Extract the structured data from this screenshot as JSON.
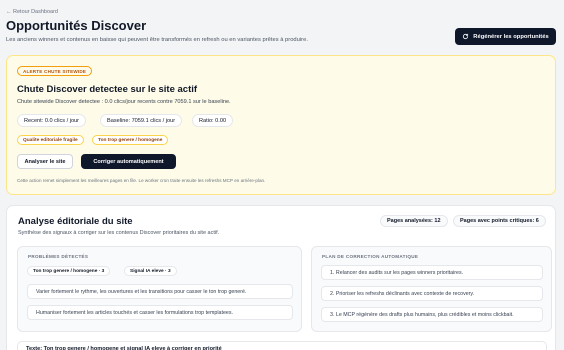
{
  "header": {
    "back_link": "← Retour Dashboard",
    "title": "Opportunités Discover",
    "subtitle": "Les anciens winners et contenus en baisse qui peuvent être transformés en refresh ou en variantes prêtes à produire.",
    "regenerate_label": "Régénérer les opportunités",
    "regenerate_icon": "refresh-icon"
  },
  "alert": {
    "badge": "ALERTE CHUTE SITEWIDE",
    "title": "Chute Discover detectee sur le site actif",
    "description": "Chute sitewide Discover detectee : 0.0 clics/jour recents contre 7059.1 sur le baseline.",
    "metrics": {
      "recent": "Recent: 0.0 clics / jour",
      "baseline": "Baseline: 7059.1 clics / jour",
      "ratio": "Ratio: 0.00"
    },
    "tags": [
      "Qualite editoriale fragile",
      "Ton trop genere / homogene"
    ],
    "analyze_label": "Analyser le site",
    "auto_fix_label": "Corriger automatiquement",
    "footnote": "Cette action remet simplement les meilleures pages en file. Le worker cron traite ensuite les refreshs MCP en arrière-plan."
  },
  "analysis": {
    "title": "Analyse éditoriale du site",
    "subtitle": "Synthèse des signaux à corriger sur les contenus Discover prioritaires du site actif.",
    "pages_analyzed": "Pages analysées: 12",
    "pages_critical": "Pages avec points critiques: 6",
    "problems": {
      "heading": "PROBLÈMES DÉTECTÉS",
      "chips": [
        "Ton trop genere / homogene · 3",
        "Signal IA eleve · 3"
      ],
      "items": [
        "Varier fortement le rythme, les ouvertures et les transitions pour casser le ton trop generé.",
        "Humaniser fortement les articles touchés et casser les formulations trop templatees."
      ]
    },
    "plan": {
      "heading": "PLAN DE CORRECTION AUTOMATIQUE",
      "items": [
        "1. Relancer des audits sur les pages winners prioritaires.",
        "2. Prioriser les refreshs déclinants avec contexte de recovery.",
        "3. Le MCP régénère des drafts plus humains, plus crédibles et moins clickbait."
      ]
    },
    "bottom_text": "Texte: Ton trop genere / homogene et signal IA eleve à corriger en priorité"
  }
}
